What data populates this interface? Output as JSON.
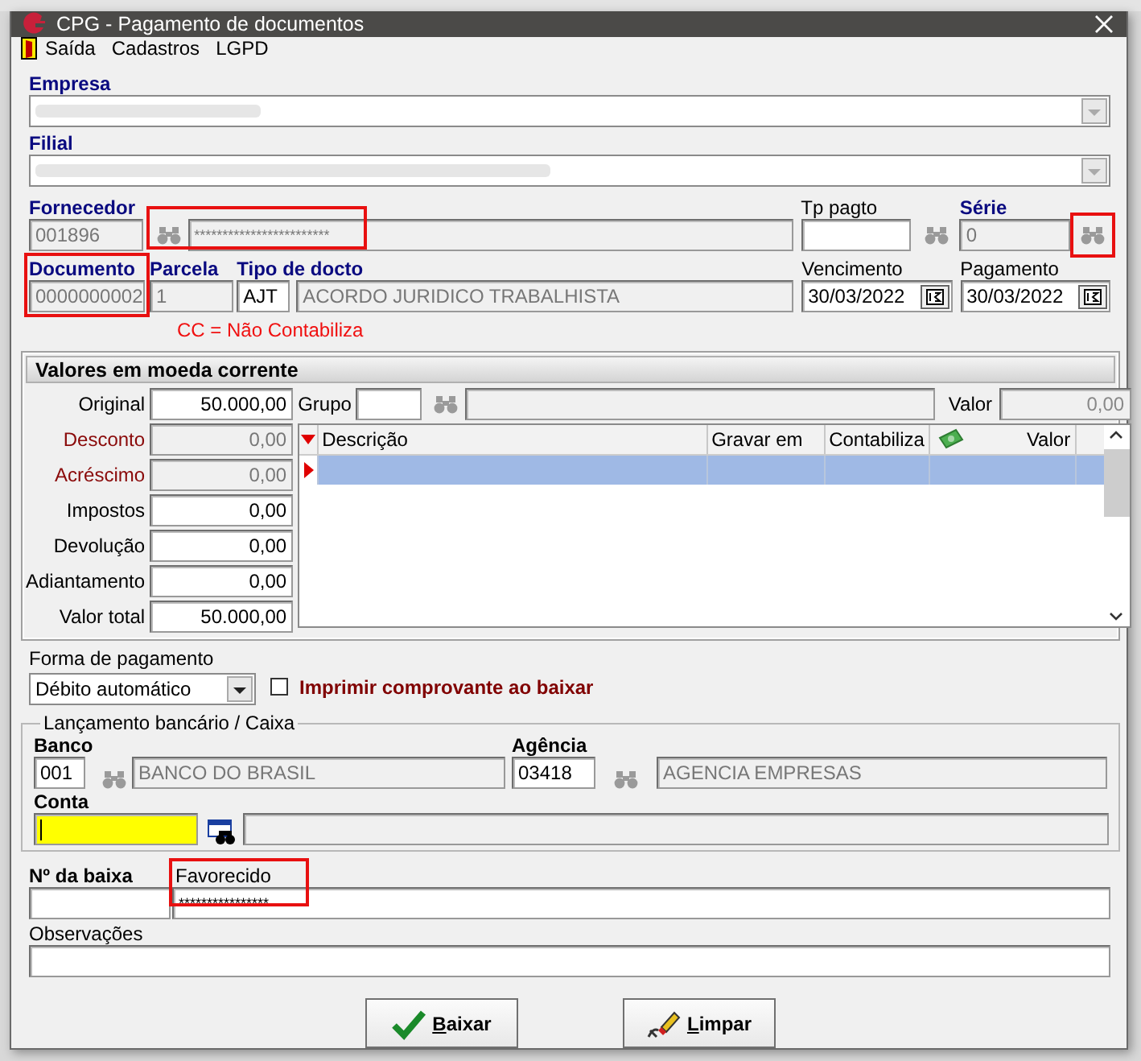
{
  "window": {
    "title": "CPG - Pagamento de documentos"
  },
  "menu": [
    {
      "label": "Saída",
      "kind": "exit"
    },
    {
      "label": "Cadastros",
      "kind": "plain"
    },
    {
      "label": "LGPD",
      "kind": "plain"
    }
  ],
  "empresa": {
    "label": "Empresa"
  },
  "filial": {
    "label": "Filial"
  },
  "fornecedor": {
    "label": "Fornecedor",
    "code": "001896",
    "name": "************************",
    "highlighted": true
  },
  "tp_pagto": {
    "label": "Tp pagto"
  },
  "serie": {
    "label": "Série",
    "value": "0",
    "search_highlighted": true
  },
  "documento": {
    "label": "Documento",
    "value": "0000000002",
    "highlighted": true
  },
  "parcela": {
    "label": "Parcela",
    "value": "1"
  },
  "tipo_docto": {
    "label": "Tipo de docto",
    "code": "AJT",
    "description": "ACORDO JURIDICO TRABALHISTA"
  },
  "vencimento": {
    "label": "Vencimento",
    "value": "30/03/2022"
  },
  "pagamento": {
    "label": "Pagamento",
    "value": "30/03/2022"
  },
  "note": "CC = Não Contabiliza",
  "valores": {
    "title": "Valores em moeda corrente",
    "amounts": [
      {
        "label": "Original",
        "value": "50.000,00",
        "kind": "plain",
        "disabled": false
      },
      {
        "label": "Desconto",
        "value": "0,00",
        "kind": "warning",
        "disabled": true
      },
      {
        "label": "Acréscimo",
        "value": "0,00",
        "kind": "warning",
        "disabled": true
      },
      {
        "label": "Impostos",
        "value": "0,00",
        "kind": "plain",
        "disabled": false
      },
      {
        "label": "Devolução",
        "value": "0,00",
        "kind": "plain",
        "disabled": false
      },
      {
        "label": "Adiantamento",
        "value": "0,00",
        "kind": "plain",
        "disabled": false
      },
      {
        "label": "Valor total",
        "value": "50.000,00",
        "kind": "plain",
        "disabled": false
      }
    ],
    "grupo": {
      "label": "Grupo"
    },
    "valor": {
      "label": "Valor",
      "value": "0,00"
    },
    "grid": {
      "columns": [
        {
          "label": "Descrição",
          "kind": "text"
        },
        {
          "label": "Gravar em",
          "kind": "text"
        },
        {
          "label": "Contabiliza",
          "kind": "text"
        },
        {
          "label": "Valor",
          "kind": "money"
        }
      ],
      "rows": [
        {
          "selected": true
        }
      ]
    }
  },
  "forma_pagamento": {
    "label": "Forma de pagamento",
    "value": "Débito automático"
  },
  "imprimir": {
    "label": "Imprimir comprovante ao baixar",
    "checked": false
  },
  "lancamento": {
    "title": "Lançamento bancário / Caixa",
    "banco": {
      "label": "Banco",
      "code": "001",
      "name": "BANCO DO BRASIL"
    },
    "agencia": {
      "label": "Agência",
      "code": "03418",
      "name": "AGENCIA EMPRESAS"
    },
    "conta": {
      "label": "Conta",
      "focused": true
    }
  },
  "baixa": {
    "label": "Nº da baixa"
  },
  "favorecido": {
    "label": "Favorecido",
    "value": "****************",
    "highlighted": true
  },
  "observacoes": {
    "label": "Observações"
  },
  "buttons": [
    {
      "label": "Baixar",
      "kind": "confirm"
    },
    {
      "label": "Limpar",
      "kind": "clear"
    }
  ]
}
